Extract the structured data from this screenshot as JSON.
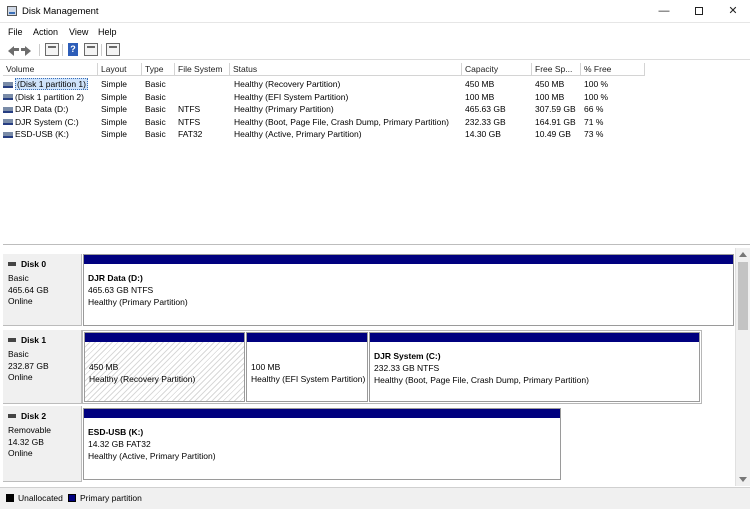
{
  "window": {
    "title": "Disk Management",
    "minimize": "—",
    "close": "✕"
  },
  "menu": [
    "File",
    "Action",
    "View",
    "Help"
  ],
  "toolbar": [
    "back-icon",
    "forward-icon",
    "properties-icon",
    "help-icon",
    "view-icon",
    "rescan-icon"
  ],
  "columns": [
    "Volume",
    "Layout",
    "Type",
    "File System",
    "Status",
    "Capacity",
    "Free Sp...",
    "% Free"
  ],
  "volumes": [
    {
      "name": "(Disk 1 partition 1)",
      "layout": "Simple",
      "type": "Basic",
      "fs": "",
      "status": "Healthy (Recovery Partition)",
      "capacity": "450 MB",
      "free": "450 MB",
      "pct": "100 %",
      "selected": true
    },
    {
      "name": "(Disk 1 partition 2)",
      "layout": "Simple",
      "type": "Basic",
      "fs": "",
      "status": "Healthy (EFI System Partition)",
      "capacity": "100 MB",
      "free": "100 MB",
      "pct": "100 %"
    },
    {
      "name": "DJR Data (D:)",
      "layout": "Simple",
      "type": "Basic",
      "fs": "NTFS",
      "status": "Healthy (Primary Partition)",
      "capacity": "465.63 GB",
      "free": "307.59 GB",
      "pct": "66 %"
    },
    {
      "name": "DJR System (C:)",
      "layout": "Simple",
      "type": "Basic",
      "fs": "NTFS",
      "status": "Healthy (Boot, Page File, Crash Dump, Primary Partition)",
      "capacity": "232.33 GB",
      "free": "164.91 GB",
      "pct": "71 %"
    },
    {
      "name": "ESD-USB (K:)",
      "layout": "Simple",
      "type": "Basic",
      "fs": "FAT32",
      "status": "Healthy (Active, Primary Partition)",
      "capacity": "14.30 GB",
      "free": "10.49 GB",
      "pct": "73 %"
    }
  ],
  "disks": [
    {
      "name": "Disk 0",
      "type": "Basic",
      "size": "465.64 GB",
      "state": "Online",
      "partitions": [
        {
          "title": "DJR Data  (D:)",
          "line1": "465.63 GB NTFS",
          "line2": "Healthy (Primary Partition)"
        }
      ]
    },
    {
      "name": "Disk 1",
      "type": "Basic",
      "size": "232.87 GB",
      "state": "Online",
      "partitions": [
        {
          "title": "",
          "line1": "450 MB",
          "line2": "Healthy (Recovery Partition)"
        },
        {
          "title": "",
          "line1": "100 MB",
          "line2": "Healthy (EFI System Partition)"
        },
        {
          "title": "DJR System  (C:)",
          "line1": "232.33 GB NTFS",
          "line2": "Healthy (Boot, Page File, Crash Dump, Primary Partition)"
        }
      ]
    },
    {
      "name": "Disk 2",
      "type": "Removable",
      "size": "14.32 GB",
      "state": "Online",
      "partitions": [
        {
          "title": "ESD-USB  (K:)",
          "line1": "14.32 GB FAT32",
          "line2": "Healthy (Active, Primary Partition)"
        }
      ]
    }
  ],
  "legend": [
    {
      "label": "Unallocated",
      "color": "#000000"
    },
    {
      "label": "Primary partition",
      "color": "#00007f"
    }
  ],
  "colors": {
    "partition_bar": "#00007f",
    "selection": "#cfe3fb"
  }
}
